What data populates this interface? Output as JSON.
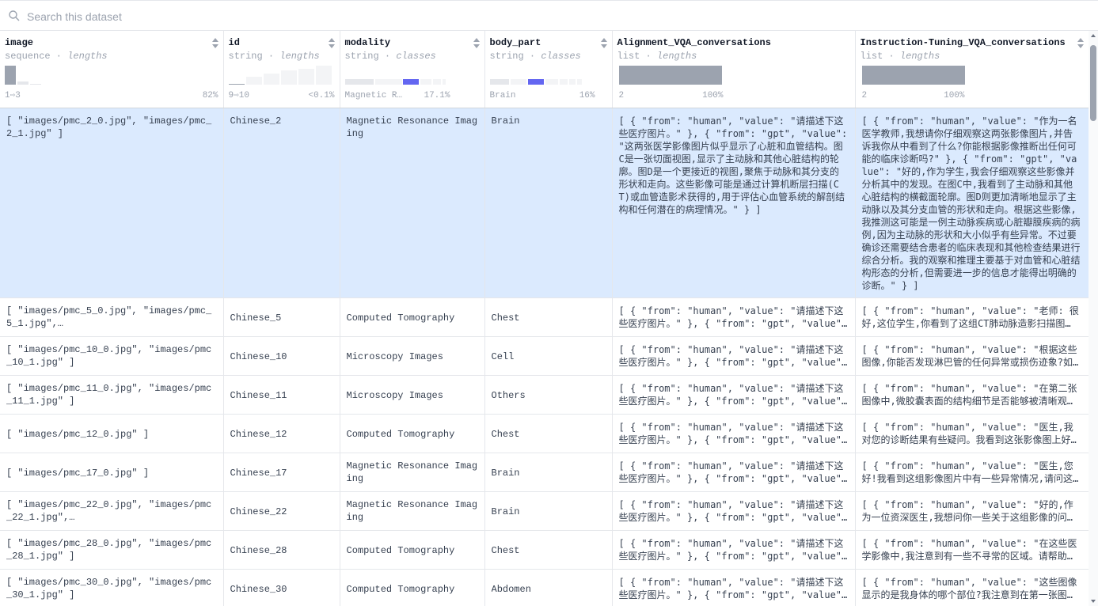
{
  "search": {
    "placeholder": "Search this dataset"
  },
  "columns": [
    {
      "name": "image",
      "dtype": "sequence",
      "stat": "lengths",
      "range_left": "1⇨3",
      "range_right": "82%"
    },
    {
      "name": "id",
      "dtype": "string",
      "stat": "lengths",
      "range_left": "9⇨10",
      "range_right": "<0.1%"
    },
    {
      "name": "modality",
      "dtype": "string",
      "stat": "classes",
      "range_left": "Magnetic R…",
      "range_right": "17.1%"
    },
    {
      "name": "body_part",
      "dtype": "string",
      "stat": "classes",
      "range_left": "Brain",
      "range_right": "16%"
    },
    {
      "name": "Alignment_VQA_conversations",
      "dtype": "list",
      "stat": "lengths",
      "range_left": "2",
      "range_right": "100%"
    },
    {
      "name": "Instruction-Tuning_VQA_conversations",
      "dtype": "list",
      "stat": "lengths",
      "range_left": "2",
      "range_right": "100%"
    }
  ],
  "type_separator": " · ",
  "colors": {
    "accent": "#6366f1",
    "bar_gray": "#9ca3af",
    "bar_light": "#e5e7eb",
    "selected_row": "#dbeafe"
  },
  "rows": [
    {
      "image": "[ \"images/pmc_2_0.jpg\", \"images/pmc_2_1.jpg\" ]",
      "id": "Chinese_2",
      "modality": "Magnetic Resonance Imaging",
      "body_part": "Brain",
      "alignment": "[ { \"from\": \"human\", \"value\": \"请描述下这些医疗图片。\" }, { \"from\": \"gpt\", \"value\": \"这两张医学影像图片似乎显示了心脏和血管结构。图C是一张切面视图,显示了主动脉和其他心脏结构的轮廓。图D是一个更接近的视图,聚焦于动脉和其分支的形状和走向。这些影像可能是通过计算机断层扫描(CT)或血管造影术获得的,用于评估心血管系统的解剖结构和任何潜在的病理情况。\" } ]",
      "instruction": "[ { \"from\": \"human\", \"value\": \"作为一名医学教师,我想请你仔细观察这两张影像图片,并告诉我你从中看到了什么?你能根据影像推断出任何可能的临床诊断吗?\" }, { \"from\": \"gpt\", \"value\": \"好的,作为学生,我会仔细观察这些影像并分析其中的发现。在图C中,我看到了主动脉和其他心脏结构的横截面轮廓。图D则更加清晰地显示了主动脉以及其分支血管的形状和走向。根据这些影像,我推测这可能是一例主动脉疾病或心脏瓣膜疾病的病例,因为主动脉的形状和大小似乎有些异常。不过要确诊还需要结合患者的临床表现和其他检查结果进行综合分析。我的观察和推理主要基于对血管和心脏结构形态的分析,但需要进一步的信息才能得出明确的诊断。\" } ]"
    },
    {
      "image": "[ \"images/pmc_5_0.jpg\", \"images/pmc_5_1.jpg\",…",
      "id": "Chinese_5",
      "modality": "Computed Tomography",
      "body_part": "Chest",
      "alignment": "[ { \"from\": \"human\", \"value\": \"请描述下这些医疗图片。\" }, { \"from\": \"gpt\", \"value\"…",
      "instruction": "[ { \"from\": \"human\", \"value\": \"老师: 很好,这位学生,你看到了这组CT肺动脉造影扫描图…"
    },
    {
      "image": "[ \"images/pmc_10_0.jpg\", \"images/pmc_10_1.jpg\" ]",
      "id": "Chinese_10",
      "modality": "Microscopy Images",
      "body_part": "Cell",
      "alignment": "[ { \"from\": \"human\", \"value\": \"请描述下这些医疗图片。\" }, { \"from\": \"gpt\", \"value\"…",
      "instruction": "[ { \"from\": \"human\", \"value\": \"根据这些图像,你能否发现淋巴管的任何异常或损伤迹象?如…"
    },
    {
      "image": "[ \"images/pmc_11_0.jpg\", \"images/pmc_11_1.jpg\" ]",
      "id": "Chinese_11",
      "modality": "Microscopy Images",
      "body_part": "Others",
      "alignment": "[ { \"from\": \"human\", \"value\": \"请描述下这些医疗图片。\" }, { \"from\": \"gpt\", \"value\"…",
      "instruction": "[ { \"from\": \"human\", \"value\": \"在第二张图像中,微胶囊表面的结构细节是否能够被清晰观察…"
    },
    {
      "image": "[ \"images/pmc_12_0.jpg\" ]",
      "id": "Chinese_12",
      "modality": "Computed Tomography",
      "body_part": "Chest",
      "alignment": "[ { \"from\": \"human\", \"value\": \"请描述下这些医疗图片。\" }, { \"from\": \"gpt\", \"value\"…",
      "instruction": "[ { \"from\": \"human\", \"value\": \"医生,我对您的诊断结果有些疑问。我看到这张影像图上好像…"
    },
    {
      "image": "[ \"images/pmc_17_0.jpg\" ]",
      "id": "Chinese_17",
      "modality": "Magnetic Resonance Imaging",
      "body_part": "Brain",
      "alignment": "[ { \"from\": \"human\", \"value\": \"请描述下这些医疗图片。\" }, { \"from\": \"gpt\", \"value\"…",
      "instruction": "[ { \"from\": \"human\", \"value\": \"医生,您好!我看到这组影像图片中有一些异常情况,请问这…"
    },
    {
      "image": "[ \"images/pmc_22_0.jpg\", \"images/pmc_22_1.jpg\",…",
      "id": "Chinese_22",
      "modality": "Magnetic Resonance Imaging",
      "body_part": "Brain",
      "alignment": "[ { \"from\": \"human\", \"value\": \"请描述下这些医疗图片。\" }, { \"from\": \"gpt\", \"value\"…",
      "instruction": "[ { \"from\": \"human\", \"value\": \"好的,作为一位资深医生,我想问你一些关于这组影像的问题。…"
    },
    {
      "image": "[ \"images/pmc_28_0.jpg\", \"images/pmc_28_1.jpg\" ]",
      "id": "Chinese_28",
      "modality": "Computed Tomography",
      "body_part": "Chest",
      "alignment": "[ { \"from\": \"human\", \"value\": \"请描述下这些医疗图片。\" }, { \"from\": \"gpt\", \"value\"…",
      "instruction": "[ { \"from\": \"human\", \"value\": \"在这些医学影像中,我注意到有一些不寻常的区域。请帮助我…"
    },
    {
      "image": "[ \"images/pmc_30_0.jpg\", \"images/pmc_30_1.jpg\" ]",
      "id": "Chinese_30",
      "modality": "Computed Tomography",
      "body_part": "Abdomen",
      "alignment": "[ { \"from\": \"human\", \"value\": \"请描述下这些医疗图片。\" }, { \"from\": \"gpt\", \"value\"…",
      "instruction": "[ { \"from\": \"human\", \"value\": \"这些图像显示的是我身体的哪个部位?我注意到在第一张图像…"
    }
  ]
}
